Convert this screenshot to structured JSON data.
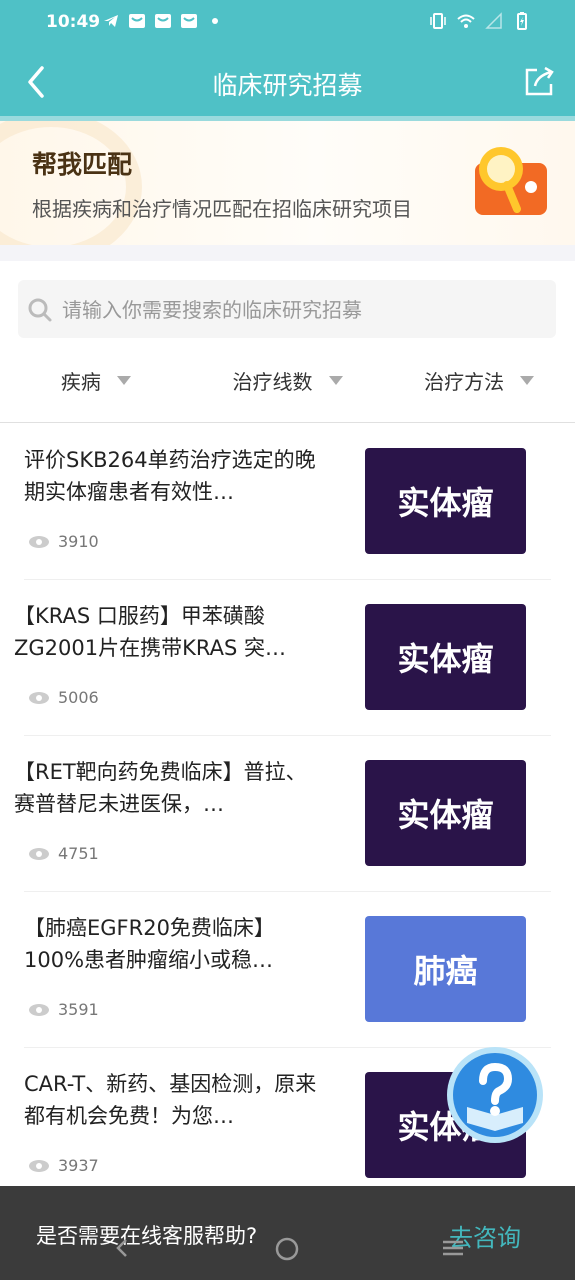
{
  "status_bar": {
    "time": "10:49"
  },
  "header": {
    "title": "临床研究招募"
  },
  "banner": {
    "title": "帮我匹配",
    "subtitle": "根据疾病和治疗情况匹配在招临床研究项目"
  },
  "search": {
    "placeholder": "请输入你需要搜索的临床研究招募",
    "value": ""
  },
  "filters": [
    {
      "label": "疾病"
    },
    {
      "label": "治疗线数"
    },
    {
      "label": "治疗方法"
    }
  ],
  "items": [
    {
      "title": "评价SKB264单药治疗选定的晚期实体瘤患者有效性…",
      "views": "3910",
      "tag": "实体瘤",
      "tag_color": "#2a1449"
    },
    {
      "title": "【KRAS 口服药】甲苯磺酸ZG2001片在携带KRAS 突…",
      "views": "5006",
      "tag": "实体瘤",
      "tag_color": "#2a1449"
    },
    {
      "title": "【RET靶向药免费临床】普拉、赛普替尼未进医保，…",
      "views": "4751",
      "tag": "实体瘤",
      "tag_color": "#2a1449"
    },
    {
      "title": "【肺癌EGFR20免费临床】100%患者肿瘤缩小或稳…",
      "views": "3591",
      "tag": "肺癌",
      "tag_color": "#5878d8"
    },
    {
      "title": "CAR-T、新药、基因检测，原来都有机会免费！为您…",
      "views": "3937",
      "tag": "实体瘤",
      "tag_color": "#2a1449"
    }
  ],
  "bottom_bar": {
    "question": "是否需要在线客服帮助?",
    "action": "去咨询"
  },
  "colors": {
    "header": "#4fc1c6",
    "tag_dark": "#2a1449",
    "tag_blue": "#5878d8",
    "link": "#43b7bd"
  }
}
